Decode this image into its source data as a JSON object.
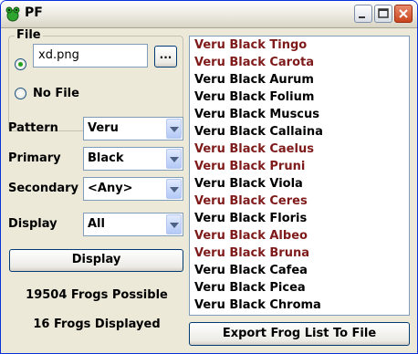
{
  "window": {
    "title": "PF",
    "app_icon": "frog-icon"
  },
  "file_group": {
    "label": "File",
    "file_radio_selected": true,
    "filename": "xd.png",
    "browse_label": "...",
    "no_file_label": "No File"
  },
  "filters": {
    "pattern": {
      "label": "Pattern",
      "value": "Veru"
    },
    "primary": {
      "label": "Primary",
      "value": "Black"
    },
    "secondary": {
      "label": "Secondary",
      "value": "<Any>"
    },
    "display": {
      "label": "Display",
      "value": "All"
    }
  },
  "display_button": "Display",
  "stats": {
    "possible": "19504 Frogs Possible",
    "displayed": "16 Frogs Displayed"
  },
  "colors": {
    "highlight": "#7f1a1a",
    "normal": "#000000"
  },
  "frog_list": [
    {
      "name": "Veru Black Tingo",
      "highlighted": true
    },
    {
      "name": "Veru Black Carota",
      "highlighted": true
    },
    {
      "name": "Veru Black Aurum",
      "highlighted": false
    },
    {
      "name": "Veru Black Folium",
      "highlighted": false
    },
    {
      "name": "Veru Black Muscus",
      "highlighted": false
    },
    {
      "name": "Veru Black Callaina",
      "highlighted": false
    },
    {
      "name": "Veru Black Caelus",
      "highlighted": true
    },
    {
      "name": "Veru Black Pruni",
      "highlighted": true
    },
    {
      "name": "Veru Black Viola",
      "highlighted": false
    },
    {
      "name": "Veru Black Ceres",
      "highlighted": true
    },
    {
      "name": "Veru Black Floris",
      "highlighted": false
    },
    {
      "name": "Veru Black Albeo",
      "highlighted": true
    },
    {
      "name": "Veru Black Bruna",
      "highlighted": true
    },
    {
      "name": "Veru Black Cafea",
      "highlighted": false
    },
    {
      "name": "Veru Black Picea",
      "highlighted": false
    },
    {
      "name": "Veru Black Chroma",
      "highlighted": false
    }
  ],
  "export_button": "Export Frog List To File"
}
